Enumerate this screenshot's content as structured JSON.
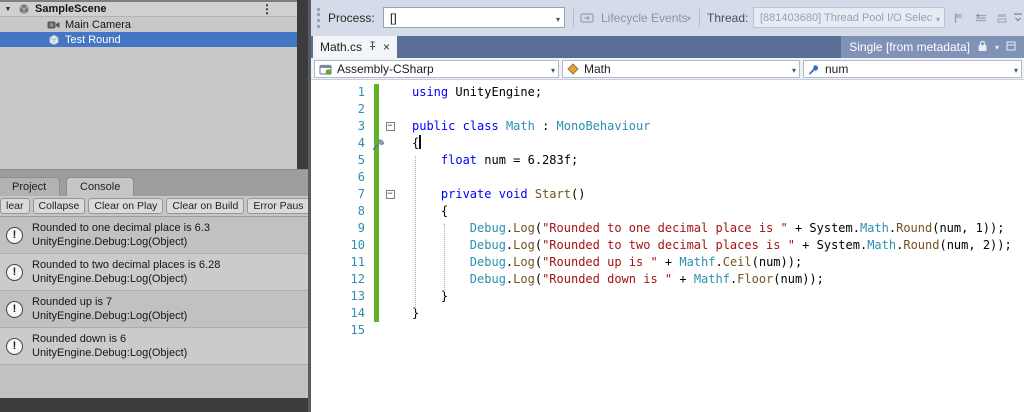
{
  "unity": {
    "hierarchy": {
      "scene_name": "SampleScene",
      "items": [
        {
          "label": "Main Camera"
        },
        {
          "label": "Test Round"
        }
      ]
    },
    "console": {
      "tabs": [
        {
          "label": "Project"
        },
        {
          "label": "Console"
        }
      ],
      "toolbar_buttons": [
        "lear",
        "Collapse",
        "Clear on Play",
        "Clear on Build",
        "Error Paus"
      ],
      "entries": [
        {
          "message": "Rounded to one decimal place is 6.3",
          "detail": "UnityEngine.Debug:Log(Object)"
        },
        {
          "message": "Rounded to two decimal places is 6.28",
          "detail": "UnityEngine.Debug:Log(Object)"
        },
        {
          "message": "Rounded up is 7",
          "detail": "UnityEngine.Debug:Log(Object)"
        },
        {
          "message": "Rounded down is 6",
          "detail": "UnityEngine.Debug:Log(Object)"
        }
      ]
    }
  },
  "vs": {
    "debug_toolbar": {
      "process_label": "Process:",
      "process_value": "[]",
      "lifecycle_label": "Lifecycle Events",
      "thread_label": "Thread:",
      "thread_value": "[881403680] Thread Pool I/O Selec"
    },
    "tab_bar": {
      "active_tab": "Math.cs",
      "metadata_tab": "Single [from metadata]",
      "close_glyph": "×"
    },
    "navigation_bar": {
      "project": "Assembly-CSharp",
      "type": "Math",
      "member": "num"
    },
    "editor": {
      "lines": [
        {
          "n": "1",
          "changed": true,
          "tokens": [
            [
              "kw",
              "using"
            ],
            [
              "pl",
              " UnityEngine;"
            ]
          ]
        },
        {
          "n": "2",
          "changed": true,
          "tokens": []
        },
        {
          "n": "3",
          "changed": true,
          "fold": true,
          "tokens": [
            [
              "kw",
              "public"
            ],
            [
              "pl",
              " "
            ],
            [
              "kw",
              "class"
            ],
            [
              "pl",
              " "
            ],
            [
              "ty",
              "Math"
            ],
            [
              "pl",
              " : "
            ],
            [
              "ty",
              "MonoBehaviour"
            ]
          ]
        },
        {
          "n": "4",
          "changed": true,
          "caret": true,
          "tokens": [
            [
              "pl",
              "{"
            ]
          ]
        },
        {
          "n": "5",
          "changed": true,
          "tokens": [
            [
              "pl",
              "    "
            ],
            [
              "kw",
              "float"
            ],
            [
              "pl",
              " num = 6.283f;"
            ]
          ]
        },
        {
          "n": "6",
          "changed": true,
          "tokens": []
        },
        {
          "n": "7",
          "changed": true,
          "fold": true,
          "tokens": [
            [
              "pl",
              "    "
            ],
            [
              "kw",
              "private"
            ],
            [
              "pl",
              " "
            ],
            [
              "kw",
              "void"
            ],
            [
              "pl",
              " "
            ],
            [
              "me",
              "Start"
            ],
            [
              "pl",
              "()"
            ]
          ]
        },
        {
          "n": "8",
          "changed": true,
          "tokens": [
            [
              "pl",
              "    {"
            ]
          ]
        },
        {
          "n": "9",
          "changed": true,
          "tokens": [
            [
              "pl",
              "        "
            ],
            [
              "ty",
              "Debug"
            ],
            [
              "pl",
              "."
            ],
            [
              "me",
              "Log"
            ],
            [
              "pl",
              "("
            ],
            [
              "st",
              "\"Rounded to one decimal place is \""
            ],
            [
              "pl",
              " + System."
            ],
            [
              "ty",
              "Math"
            ],
            [
              "pl",
              "."
            ],
            [
              "me",
              "Round"
            ],
            [
              "pl",
              "(num, 1));"
            ]
          ]
        },
        {
          "n": "10",
          "changed": true,
          "tokens": [
            [
              "pl",
              "        "
            ],
            [
              "ty",
              "Debug"
            ],
            [
              "pl",
              "."
            ],
            [
              "me",
              "Log"
            ],
            [
              "pl",
              "("
            ],
            [
              "st",
              "\"Rounded to two decimal places is \""
            ],
            [
              "pl",
              " + System."
            ],
            [
              "ty",
              "Math"
            ],
            [
              "pl",
              "."
            ],
            [
              "me",
              "Round"
            ],
            [
              "pl",
              "(num, 2));"
            ]
          ]
        },
        {
          "n": "11",
          "changed": true,
          "tokens": [
            [
              "pl",
              "        "
            ],
            [
              "ty",
              "Debug"
            ],
            [
              "pl",
              "."
            ],
            [
              "me",
              "Log"
            ],
            [
              "pl",
              "("
            ],
            [
              "st",
              "\"Rounded up is \""
            ],
            [
              "pl",
              " + "
            ],
            [
              "ty",
              "Mathf"
            ],
            [
              "pl",
              "."
            ],
            [
              "me",
              "Ceil"
            ],
            [
              "pl",
              "(num));"
            ]
          ]
        },
        {
          "n": "12",
          "changed": true,
          "tokens": [
            [
              "pl",
              "        "
            ],
            [
              "ty",
              "Debug"
            ],
            [
              "pl",
              "."
            ],
            [
              "me",
              "Log"
            ],
            [
              "pl",
              "("
            ],
            [
              "st",
              "\"Rounded down is \""
            ],
            [
              "pl",
              " + "
            ],
            [
              "ty",
              "Mathf"
            ],
            [
              "pl",
              "."
            ],
            [
              "me",
              "Floor"
            ],
            [
              "pl",
              "(num));"
            ]
          ]
        },
        {
          "n": "13",
          "changed": true,
          "tokens": [
            [
              "pl",
              "    }"
            ]
          ]
        },
        {
          "n": "14",
          "changed": true,
          "tokens": [
            [
              "pl",
              "}"
            ]
          ]
        },
        {
          "n": "15",
          "changed": false,
          "tokens": []
        }
      ]
    }
  },
  "colors": {
    "selection_blue": "#4377c5",
    "change_bar_green": "#5fb32b",
    "keyword_blue": "#0000ff",
    "type_teal": "#2b91af",
    "string_red": "#a31515",
    "method_brown": "#74531f",
    "line_number_teal": "#2b91af"
  }
}
